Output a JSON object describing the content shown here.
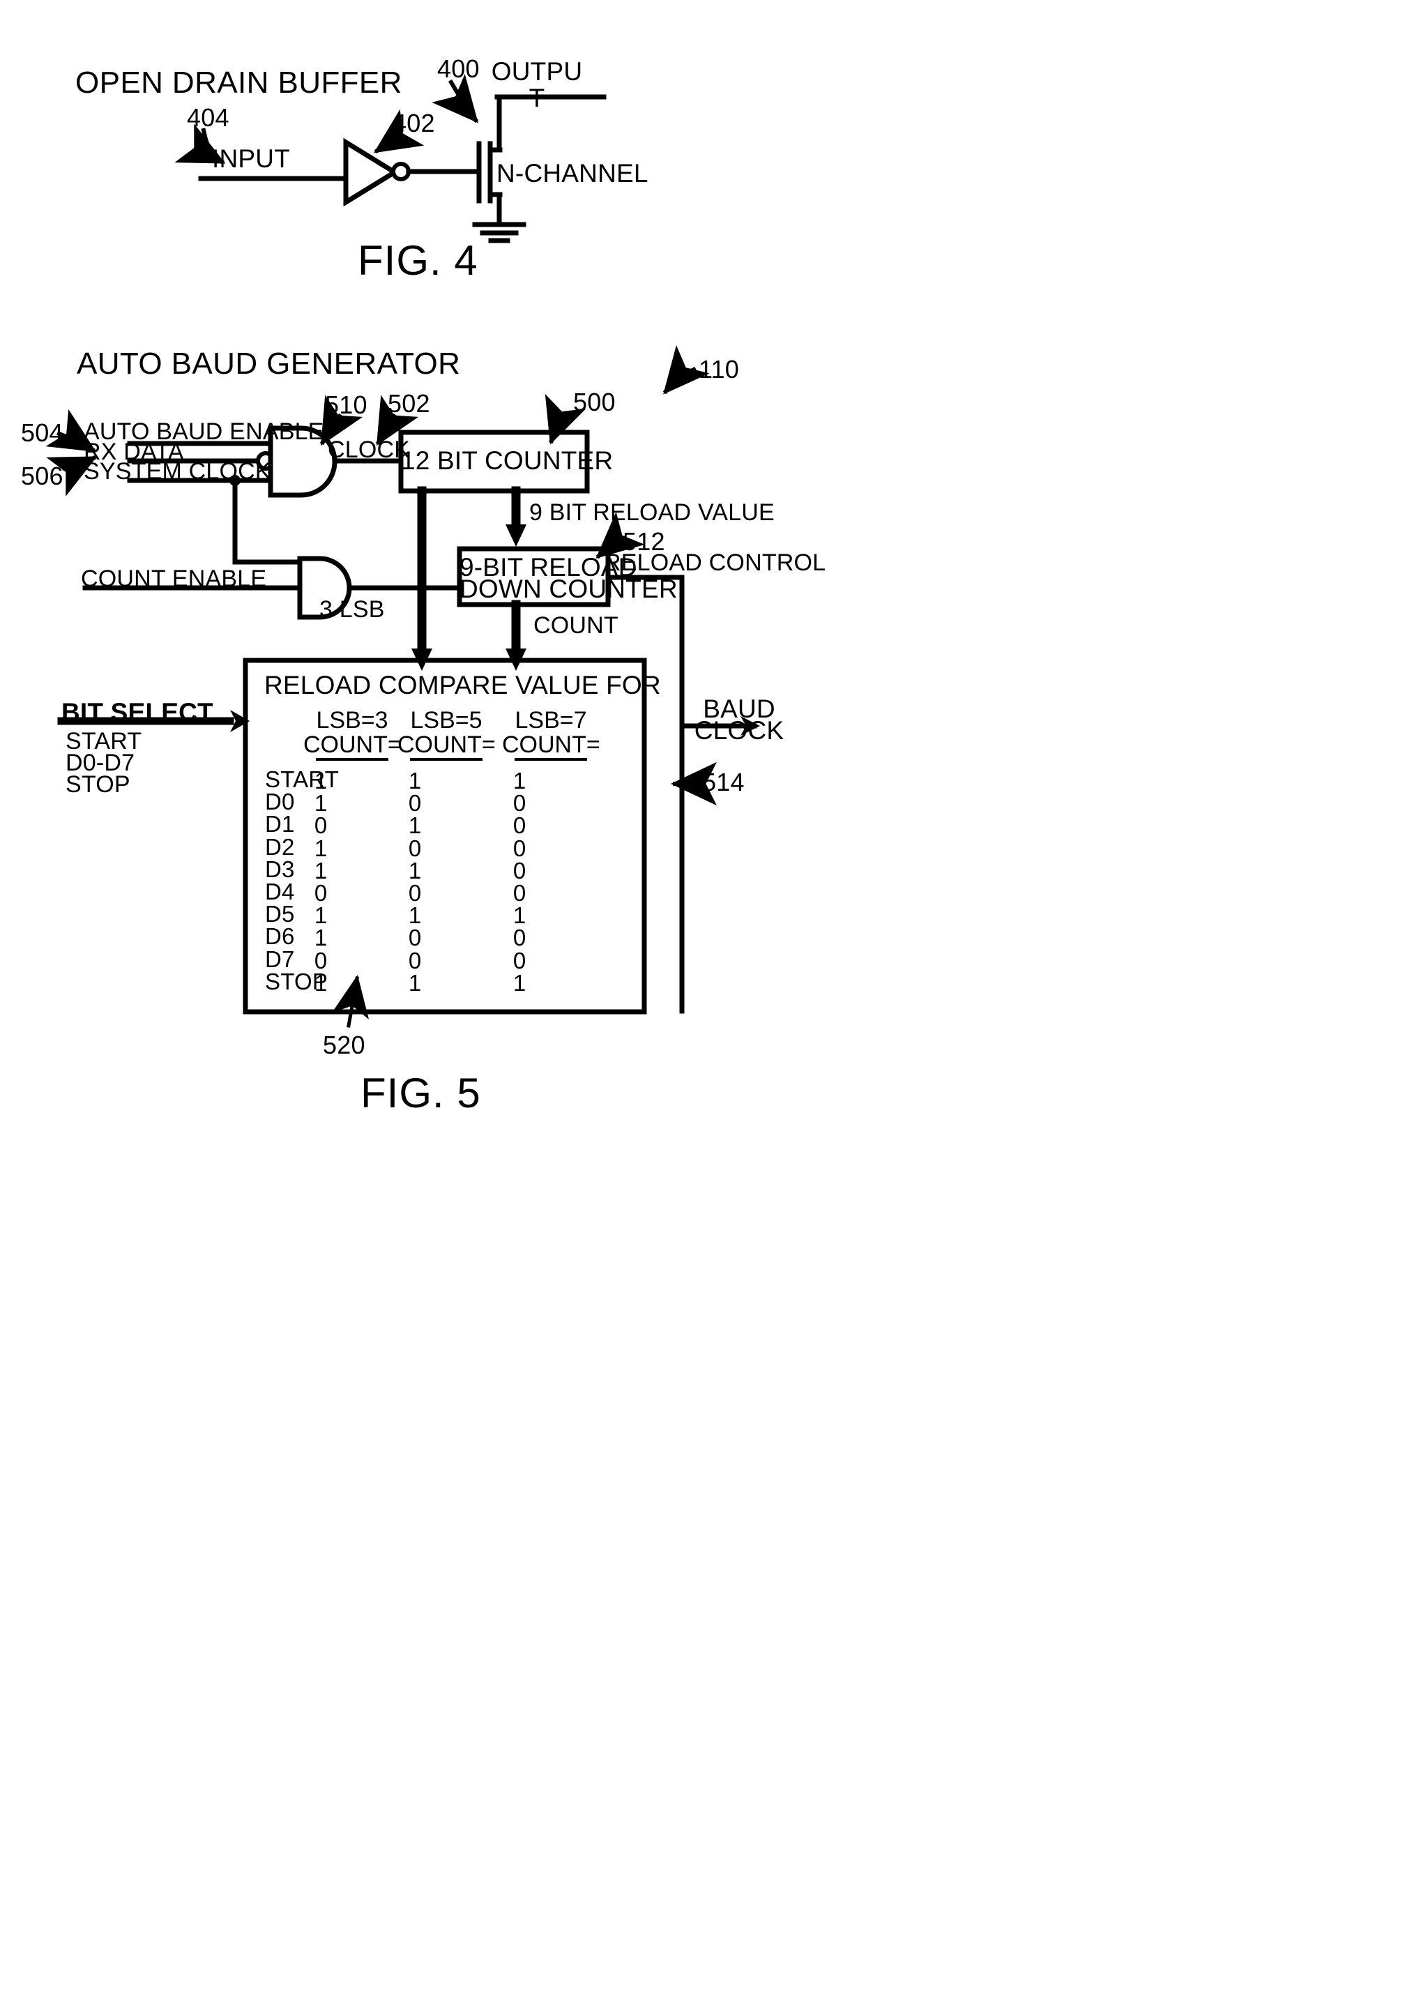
{
  "figures": [
    {
      "id": "fig4",
      "title": "OPEN DRAIN BUFFER",
      "caption": "FIG. 4",
      "labels": {
        "input": "INPUT",
        "output_line1": "OUTPU",
        "output_line2": "T",
        "nchannel": "N-CHANNEL"
      },
      "refs": {
        "r400": "400",
        "r402": "402",
        "r404": "404"
      }
    },
    {
      "id": "fig5",
      "title": "AUTO BAUD GENERATOR",
      "caption": "FIG. 5",
      "inputs": {
        "auto_baud_enable": "AUTO BAUD ENABLE",
        "rx_data": "RX DATA",
        "system_clock": "SYSTEM CLOCK",
        "count_enable": "COUNT ENABLE",
        "bit_select": "BIT SELECT",
        "bit_select_items": [
          "START",
          "D0-D7",
          "STOP"
        ]
      },
      "blocks": {
        "counter12": "12 BIT COUNTER",
        "downcounter_line1": "9-BIT RELOAD",
        "downcounter_line2": "DOWN COUNTER",
        "table_title": "RELOAD COMPARE VALUE FOR"
      },
      "signals": {
        "clock": "CLOCK",
        "reload_value": "9 BIT RELOAD VALUE",
        "reload_control": "RELOAD CONTROL",
        "count": "COUNT",
        "lsb3": "3 LSB",
        "baud_clock_line1": "BAUD",
        "baud_clock_line2": "CLOCK"
      },
      "refs": {
        "r110": "110",
        "r500": "500",
        "r502": "502",
        "r504": "504",
        "r506": "506",
        "r510": "510",
        "r512": "512",
        "r514": "514",
        "r520": "520"
      }
    }
  ],
  "chart_data": {
    "type": "table",
    "title": "RELOAD COMPARE VALUE FOR",
    "columns": [
      {
        "header_line1": "",
        "header_line2": ""
      },
      {
        "header_line1": "LSB=3",
        "header_line2": "COUNT="
      },
      {
        "header_line1": "LSB=5",
        "header_line2": "COUNT="
      },
      {
        "header_line1": "LSB=7",
        "header_line2": "COUNT="
      }
    ],
    "row_labels": [
      "START",
      "D0",
      "D1",
      "D2",
      "D3",
      "D4",
      "D5",
      "D6",
      "D7",
      "STOP"
    ],
    "series": [
      {
        "name": "LSB=3 COUNT=",
        "values": [
          1,
          1,
          0,
          1,
          1,
          0,
          1,
          1,
          0,
          1
        ]
      },
      {
        "name": "LSB=5 COUNT=",
        "values": [
          1,
          0,
          1,
          0,
          1,
          0,
          1,
          0,
          0,
          1
        ]
      },
      {
        "name": "LSB=7 COUNT=",
        "values": [
          1,
          0,
          0,
          0,
          0,
          0,
          1,
          0,
          0,
          1
        ]
      }
    ],
    "rows": [
      {
        "label": "START",
        "values": [
          1,
          1,
          1
        ]
      },
      {
        "label": "D0",
        "values": [
          1,
          0,
          0
        ]
      },
      {
        "label": "D1",
        "values": [
          0,
          1,
          0
        ]
      },
      {
        "label": "D2",
        "values": [
          1,
          0,
          0
        ]
      },
      {
        "label": "D3",
        "values": [
          1,
          1,
          0
        ]
      },
      {
        "label": "D4",
        "values": [
          0,
          0,
          0
        ]
      },
      {
        "label": "D5",
        "values": [
          1,
          1,
          1
        ]
      },
      {
        "label": "D6",
        "values": [
          1,
          0,
          0
        ]
      },
      {
        "label": "D7",
        "values": [
          0,
          0,
          0
        ]
      },
      {
        "label": "STOP",
        "values": [
          1,
          1,
          1
        ]
      }
    ],
    "grid": false,
    "legend": "none"
  },
  "style": {
    "ink": "#000000",
    "paper": "#ffffff"
  }
}
